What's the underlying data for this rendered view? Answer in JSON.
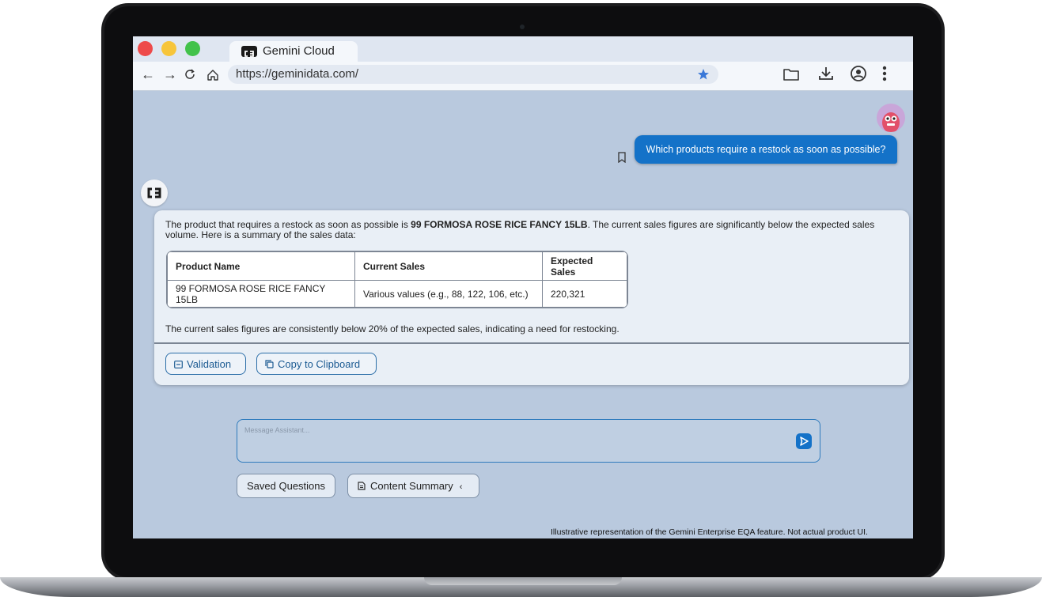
{
  "browser": {
    "tab_title": "Gemini Cloud",
    "url": "https://geminidata.com/",
    "traffic_colors": [
      "#ee4a4a",
      "#f7c53a",
      "#42c24a"
    ]
  },
  "chat": {
    "user_message": "Which products require a restock as soon as possible?",
    "response": {
      "intro_prefix": "The product that requires a restock as soon as possible is ",
      "intro_bold": "99 FORMOSA ROSE RICE FANCY 15LB",
      "intro_suffix": ". The current sales figures are significantly below the expected sales volume. Here is a summary of the sales data:",
      "table": {
        "headers": [
          "Product Name",
          "Current Sales",
          "Expected Sales"
        ],
        "rows": [
          [
            "99 FORMOSA ROSE RICE FANCY 15LB",
            "Various values (e.g., 88, 122, 106, etc.)",
            "220,321"
          ]
        ]
      },
      "conclusion": "The current sales figures are consistently below 20% of the expected sales, indicating a need for restocking.",
      "actions": {
        "validation": "Validation",
        "copy": "Copy to Clipboard"
      }
    }
  },
  "composer": {
    "placeholder": "Message Assistant...",
    "saved_questions": "Saved Questions",
    "content_summary": "Content Summary"
  },
  "disclaimer": "Illustrative representation of the Gemini Enterprise EQA feature. Not actual product UI.",
  "colors": {
    "accent": "#1472c8",
    "background": "#b9c9de"
  }
}
